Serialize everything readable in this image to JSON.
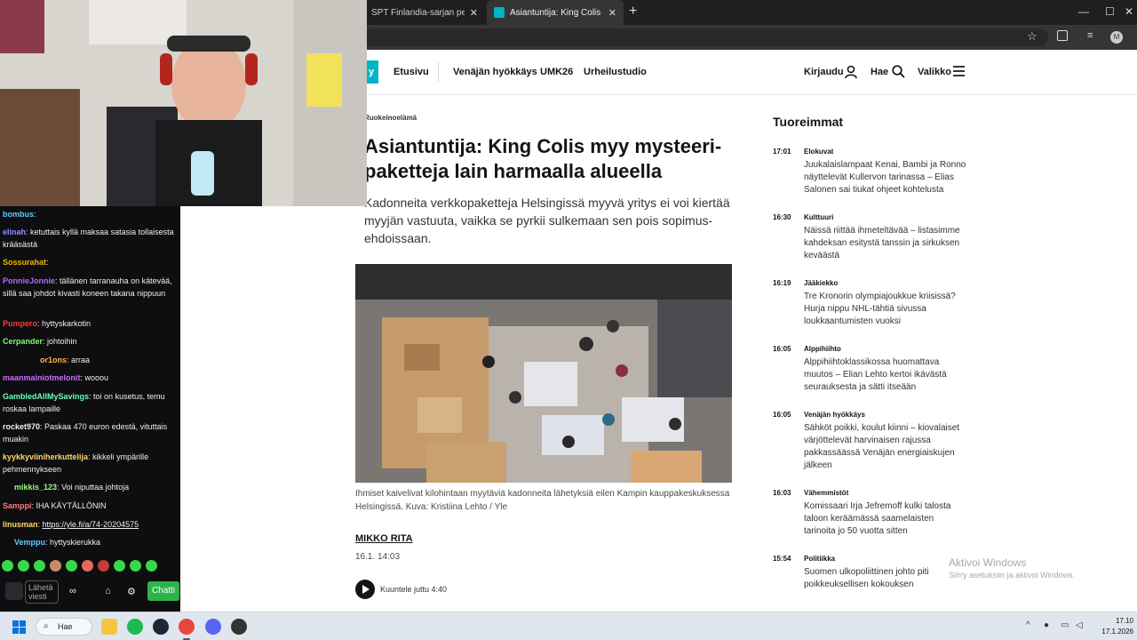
{
  "browser": {
    "tabs": [
      {
        "title": "SPT Finlandia-sarjan pelit - You",
        "active": false
      },
      {
        "title": "Asiantuntija: King Colis myy mysteeri",
        "active": true
      }
    ],
    "new_tab": "+",
    "profile_initial": "M"
  },
  "site": {
    "logo": "yle",
    "nav": [
      "Etusivu",
      "Venäjän hyökkäys",
      "UMK26",
      "Urheilustudio"
    ],
    "login": "Kirjaudu",
    "search": "Hae",
    "menu": "Valikko"
  },
  "article": {
    "category": "Ruokeinoelämä",
    "headline": "Asiantuntija: King Colis myy mysteeri-paketteja lain harmaalla alueella",
    "lead": "Kadonneita verkkopaketteja Helsingissä myyvä yritys ei voi kiertää myyjän vastuuta, vaikka se pyrkii sulkemaan sen pois sopimus-ehdoissaan.",
    "caption": "Ihmiset kaivelivat kilohintaan myytäviä kadonneita lähetyksiä eilen Kampin kauppakeskuksessa Helsingissä. Kuva: Kristiina Lehto / Yle",
    "author": "MIKKO RITA",
    "date": "16.1. 14:03",
    "listen": "Kuuntele juttu 4:40"
  },
  "latest": {
    "title": "Tuoreimmat",
    "items": [
      {
        "time": "17:01",
        "category": "Elokuvat",
        "headline": "Juukalaislampaat Kenai, Bambi ja Ronno näyttelevät Kullervon tarinassa – Elias Salonen sai tiukat ohjeet kohtelusta"
      },
      {
        "time": "16:30",
        "category": "Kulttuuri",
        "headline": "Näissä riittää ihmeteltävää – listasimme kahdeksan esitystä tanssin ja sirkuksen keväästä"
      },
      {
        "time": "16:19",
        "category": "Jääkiekko",
        "headline": "Tre Kronorin olympiajoukkue kriisissä? Hurja nippu NHL-tähtiä sivussa loukkaantumisten vuoksi"
      },
      {
        "time": "16:05",
        "category": "Alppihiihto",
        "headline": "Alppihiihtoklassikossa huomattava muutos – Elian Lehto kertoi ikävästä seurauksesta ja sätti itseään"
      },
      {
        "time": "16:05",
        "category": "Venäjän hyökkäys",
        "headline": "Sähköt poikki, koulut kiinni – kiovalaiset värjöttelevät harvinaisen rajussa pakkassäässä Venäjän energiaiskujen jälkeen"
      },
      {
        "time": "16:03",
        "category": "Vähemmistöt",
        "headline": "Komissaari Irja Jefremoff kulki talosta taloon keräämässä saamelaisten tarinoita jo 50 vuotta sitten"
      },
      {
        "time": "15:54",
        "category": "Politiikka",
        "headline": "Suomen ulkopoliittinen johto piti poikkeuksellisen kokouksen"
      }
    ]
  },
  "windows_activation": {
    "title": "Aktivoi Windows",
    "subtitle": "Siirry asetuksiin ja aktivoi Windows."
  },
  "chat": {
    "messages": [
      {
        "user": "bombus",
        "color": "#63c8ff",
        "text": ""
      },
      {
        "user": "elinah",
        "color": "#8f8fff",
        "text": "ketuttais kyllä maksaa satasia tollaisesta krääsästä"
      },
      {
        "user": "Sossurahat",
        "color": "#f0b400",
        "text": ""
      },
      {
        "user": "PonnieJonnie",
        "color": "#a96cff",
        "text": "tällänen tarranauha on kätevää, sillä saa johdot kivasti koneen takana nippuun"
      },
      {
        "user": "Pumpero",
        "color": "#ff3b3b",
        "text": "hyttyskarkotin"
      },
      {
        "user": "Cerpander",
        "color": "#7cff6b",
        "text": "johtoihin"
      },
      {
        "user": "or1ons",
        "color": "#ffb347",
        "text": "arraa"
      },
      {
        "user": "maanmainiotmelonit",
        "color": "#c86bff",
        "text": "wooou"
      },
      {
        "user": "GambledAllMySavings",
        "color": "#6bffb8",
        "text": "toi on kusetus, temu roskaa lampaille"
      },
      {
        "user": "rocket970",
        "color": "#efeff1",
        "text": "Paskaa 470 euron edestä, vituttais muakin"
      },
      {
        "user": "kyykkyviiniherkuttelija",
        "color": "#ffd86b",
        "text": "kikkeli ympärille pehmennykseen"
      },
      {
        "user": "mikkis_123",
        "color": "#9cff7c",
        "text": "Voi niputtaa johtoja"
      },
      {
        "user": "Samppi",
        "color": "#ff7c7c",
        "text": "IHA KÄYTÄLLÖNIN"
      },
      {
        "user": "linusman",
        "color": "#ffd86b",
        "text": "https://yle.fi/a/74-20204575"
      },
      {
        "user": "Vemppu",
        "color": "#63c8ff",
        "text": "hyttyskierukka"
      }
    ],
    "input_placeholder": "Lähetä viesti",
    "send_label": "Chatti"
  },
  "taskbar": {
    "search": "Hae",
    "time": "17.10",
    "date": "17.1.2026"
  }
}
